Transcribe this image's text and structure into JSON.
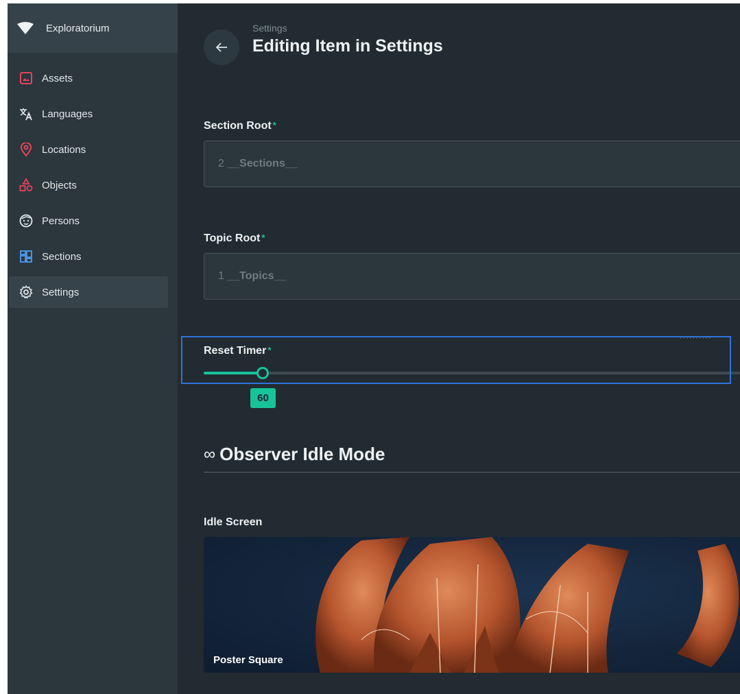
{
  "sidebar": {
    "brand": "Exploratorium",
    "items": [
      {
        "label": "Assets",
        "icon": "image-icon"
      },
      {
        "label": "Languages",
        "icon": "translate-icon"
      },
      {
        "label": "Locations",
        "icon": "map-pin-icon"
      },
      {
        "label": "Objects",
        "icon": "shapes-icon"
      },
      {
        "label": "Persons",
        "icon": "face-icon"
      },
      {
        "label": "Sections",
        "icon": "dashboard-icon"
      },
      {
        "label": "Settings",
        "icon": "gear-icon",
        "active": true
      }
    ]
  },
  "header": {
    "breadcrumb": "Settings",
    "title": "Editing Item in Settings"
  },
  "form": {
    "section_root": {
      "label": "Section Root",
      "required_mark": "*",
      "value_id": "2",
      "value_name": "__Sections__"
    },
    "topic_root": {
      "label": "Topic Root",
      "required_mark": "*",
      "value_id": "1",
      "value_name": "__Topics__"
    },
    "reset_timer": {
      "label": "Reset Timer",
      "required_mark": "*",
      "value": "60",
      "fill_fraction": 0.11
    }
  },
  "observer": {
    "heading_icon": "∞",
    "heading": "Observer Idle Mode",
    "idle_screen": {
      "label": "Idle Screen",
      "caption": "Poster Square"
    }
  },
  "colors": {
    "accent": "#18c39a",
    "background": "#222b31",
    "sidebar": "#2b363d",
    "icon_red": "#e8445a"
  }
}
